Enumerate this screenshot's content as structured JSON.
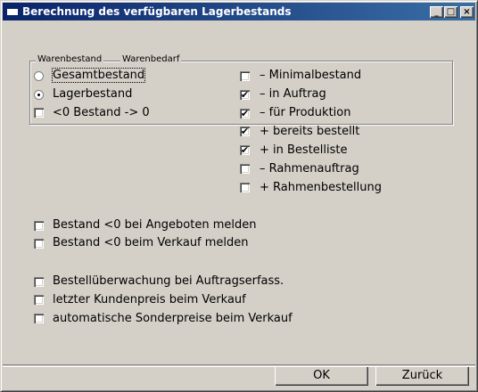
{
  "window": {
    "title": "Berechnung des verfügbaren Lagerbestands",
    "controls": {
      "minimize": "_",
      "maximize": "□",
      "close": "×"
    }
  },
  "groups": {
    "warenbestand_label": "Warenbestand",
    "warenbedarf_label": "Warenbedarf"
  },
  "warenbestand": {
    "gesamtbestand": {
      "label": "Gesamtbestand",
      "selected": false
    },
    "lagerbestand": {
      "label": "Lagerbestand",
      "selected": true
    },
    "null_bestand": {
      "label": "<0 Bestand -> 0",
      "checked": false
    }
  },
  "warenbedarf": {
    "minimalbestand": {
      "label": "– Minimalbestand",
      "checked": false
    },
    "in_auftrag": {
      "label": "– in Auftrag",
      "checked": true
    },
    "fuer_produktion": {
      "label": "– für Produktion",
      "checked": true
    },
    "bereits_bestellt": {
      "label": "+ bereits bestellt",
      "checked": true
    },
    "in_bestellliste": {
      "label": "+ in Bestelliste",
      "checked": true
    },
    "rahmenauftrag": {
      "label": "– Rahmenauftrag",
      "checked": false
    },
    "rahmenbestellung": {
      "label": "+ Rahmenbestellung",
      "checked": false
    }
  },
  "options": {
    "angebote": {
      "label": "Bestand <0 bei Angeboten melden",
      "checked": false
    },
    "verkauf": {
      "label": "Bestand <0 beim Verkauf melden",
      "checked": false
    },
    "bestellueberwachung": {
      "label": "Bestellüberwachung bei Auftragserfass.",
      "checked": false
    },
    "kundenpreis": {
      "label": "letzter Kundenpreis beim Verkauf",
      "checked": false
    },
    "sonderpreise": {
      "label": "automatische Sonderpreise beim Verkauf",
      "checked": false
    }
  },
  "buttons": {
    "ok": "OK",
    "cancel": "Zurück"
  },
  "check_glyph": "✔"
}
